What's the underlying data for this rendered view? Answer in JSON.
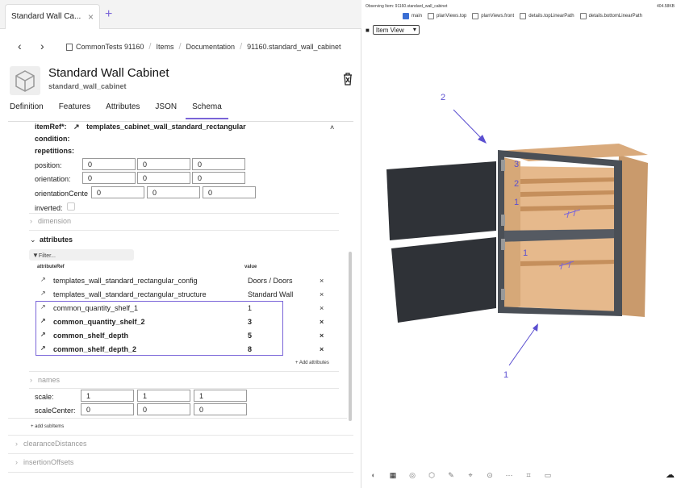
{
  "tab": {
    "title": "Standard Wall Ca...",
    "close": "×",
    "new": "+"
  },
  "nav": {
    "back": "‹",
    "forward": "›",
    "crumbs": [
      "CommonTests 91160",
      "Items",
      "Documentation",
      "91160.standard_wall_cabinet"
    ]
  },
  "item": {
    "title": "Standard Wall Cabinet",
    "subtitle": "standard_wall_cabinet"
  },
  "tabs": [
    "Definition",
    "Features",
    "Attributes",
    "JSON",
    "Schema"
  ],
  "active_tab": "Schema",
  "schema": {
    "itemref_label": "itemRef*:",
    "itemref_value": "templates_cabinet_wall_standard_rectangular",
    "condition": "condition:",
    "repetitions": "repetitions:",
    "position_label": "position:",
    "position": [
      "0",
      "0",
      "0"
    ],
    "orientation_label": "orientation:",
    "orientation": [
      "0",
      "0",
      "0"
    ],
    "orientation_center_label": "orientationCente",
    "orientation_center": [
      "0",
      "0",
      "0"
    ],
    "inverted_label": "inverted:",
    "dimension": "dimension",
    "attributes": "attributes",
    "filter": "Filter...",
    "col_ref": "attributeRef",
    "col_value": "value",
    "rows": [
      {
        "name": "templates_wall_standard_rectangular_config",
        "value": "Doors / Doors",
        "bold": false
      },
      {
        "name": "templates_wall_standard_rectangular_structure",
        "value": "Standard Wall",
        "bold": false
      },
      {
        "name": "common_quantity_shelf_1",
        "value": "1",
        "bold": false
      },
      {
        "name": "common_quantity_shelf_2",
        "value": "3",
        "bold": true
      },
      {
        "name": "common_shelf_depth",
        "value": "5",
        "bold": true
      },
      {
        "name": "common_shelf_depth_2",
        "value": "8",
        "bold": true
      }
    ],
    "remove": "×",
    "add_attributes": "+ Add attributes",
    "names": "names",
    "scale_label": "scale:",
    "scale": [
      "1",
      "1",
      "1"
    ],
    "scale_center_label": "scaleCenter:",
    "scale_center": [
      "0",
      "0",
      "0"
    ],
    "add_subitems": "+ add subItems",
    "clearance": "clearanceDistances",
    "insertion": "insertionOffsets"
  },
  "viewer": {
    "observing": "Observing Item: 91160.standard_wall_cabinet",
    "size": "404.58KB",
    "checks": [
      {
        "label": "main",
        "on": true
      },
      {
        "label": "planViews.top",
        "on": false
      },
      {
        "label": "planViews.front",
        "on": false
      },
      {
        "label": "details.topLinearPath",
        "on": false
      },
      {
        "label": "details.bottomLinearPath",
        "on": false
      }
    ],
    "view": "Item View",
    "annotations": {
      "top_arrow": "2",
      "bottom_arrow": "1",
      "s3": "3",
      "s2": "2",
      "s1": "1",
      "s1b": "1"
    },
    "accent": "#7a65d8"
  }
}
